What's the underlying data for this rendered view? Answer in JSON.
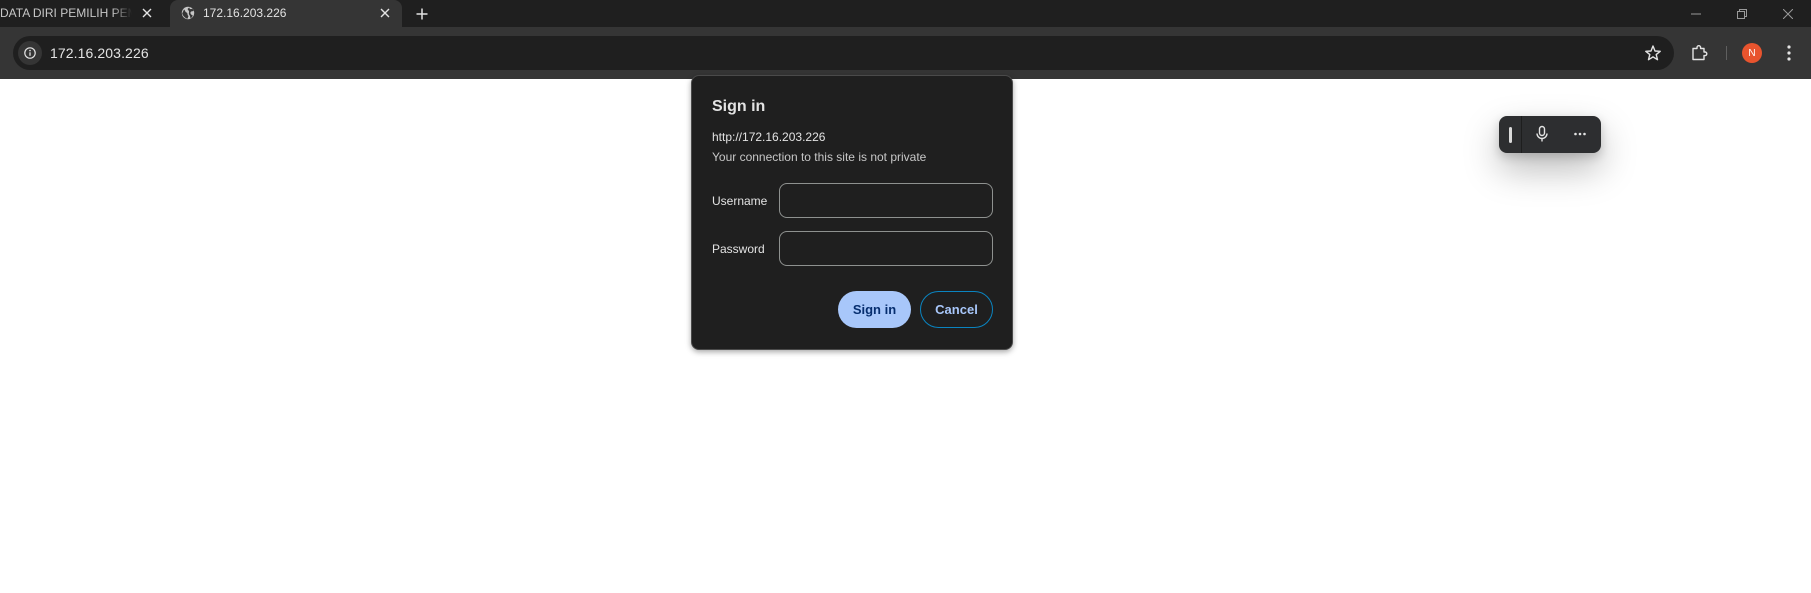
{
  "tabs": [
    {
      "title": "DATA DIRI PEMILIH PEMILU",
      "active": false
    },
    {
      "title": "172.16.203.226",
      "active": true,
      "favicon": "globe-icon"
    }
  ],
  "new_tab_icon": "plus-icon",
  "window_controls": [
    "minimize-icon",
    "restore-icon",
    "close-icon"
  ],
  "toolbar": {
    "url": "172.16.203.226",
    "site_info_icon": "info-icon",
    "bookmark_icon": "star-icon",
    "extensions_icon": "puzzle-icon",
    "profile_initial": "N",
    "profile_color": "#e8542e",
    "menu_icon": "kebab-menu-icon"
  },
  "voice_toolbar": {
    "icons": [
      "drag-handle-icon",
      "microphone-icon",
      "more-icon"
    ]
  },
  "dialog": {
    "title": "Sign in",
    "origin": "http://172.16.203.226",
    "warning": "Your connection to this site is not private",
    "username_label": "Username",
    "username_value": "",
    "password_label": "Password",
    "password_value": "",
    "signin_label": "Sign in",
    "cancel_label": "Cancel",
    "accent_color": "#a8c7fa"
  }
}
